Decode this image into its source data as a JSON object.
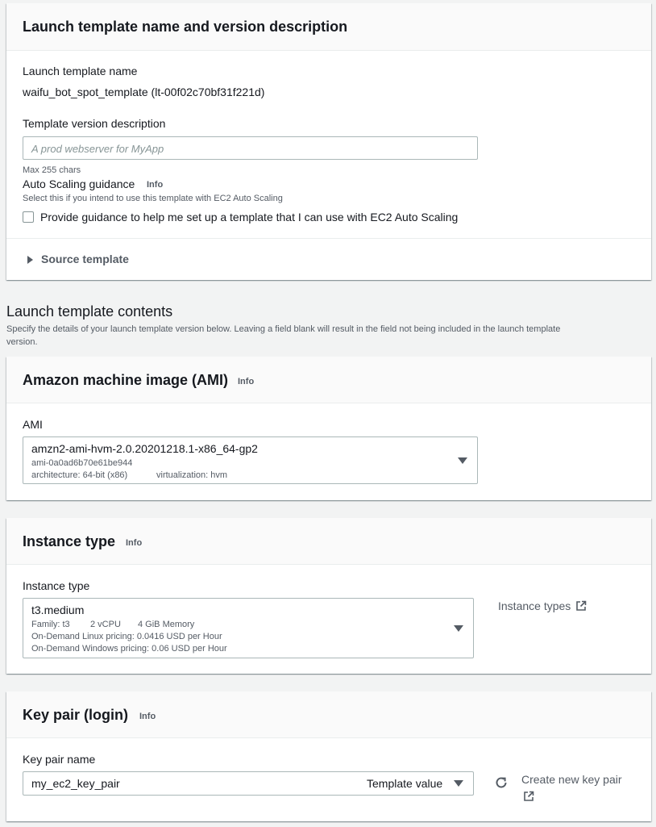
{
  "name_section": {
    "title": "Launch template name and version description",
    "template_name_label": "Launch template name",
    "template_name_value": "waifu_bot_spot_template (lt-00f02c70bf31f221d)",
    "version_desc_label": "Template version description",
    "version_desc_placeholder": "A prod webserver for MyApp",
    "max_chars": "Max 255 chars",
    "asg_label": "Auto Scaling guidance",
    "asg_info": "Info",
    "asg_desc": "Select this if you intend to use this template with EC2 Auto Scaling",
    "asg_checkbox_label": "Provide guidance to help me set up a template that I can use with EC2 Auto Scaling",
    "source_template": "Source template"
  },
  "contents": {
    "title": "Launch template contents",
    "description_line1": "Specify the details of your launch template version below. Leaving a field blank will result in the field not being included in the launch template",
    "description_line2": "version."
  },
  "ami_section": {
    "title": "Amazon machine image (AMI)",
    "info": "Info",
    "field_label": "AMI",
    "selected_name": "amzn2-ami-hvm-2.0.20201218.1-x86_64-gp2",
    "selected_id": "ami-0a0ad6b70e61be944",
    "architecture": "architecture: 64-bit (x86)",
    "virtualization": "virtualization: hvm"
  },
  "instance_section": {
    "title": "Instance type",
    "info": "Info",
    "field_label": "Instance type",
    "selected": "t3.medium",
    "family": "Family: t3",
    "vcpu": "2 vCPU",
    "memory": "4 GiB Memory",
    "linux_pricing": "On-Demand Linux pricing: 0.0416 USD per Hour",
    "windows_pricing": "On-Demand Windows pricing: 0.06 USD per Hour",
    "types_link": "Instance types"
  },
  "keypair_section": {
    "title": "Key pair (login)",
    "info": "Info",
    "field_label": "Key pair name",
    "selected": "my_ec2_key_pair",
    "template_value": "Template value",
    "create_link": "Create new key pair"
  },
  "colors": {
    "page_bg": "#f2f3f3",
    "panel_bg": "#ffffff",
    "header_bg": "#fafafa",
    "text": "#16191f",
    "muted": "#545b64",
    "border": "#aab7b8"
  }
}
